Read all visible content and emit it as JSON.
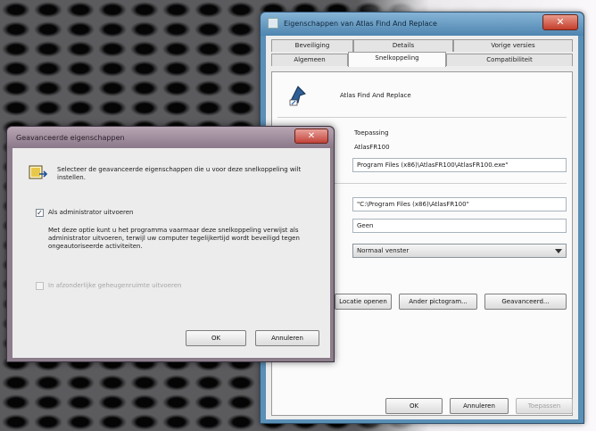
{
  "props": {
    "title": "Eigenschappen van Atlas Find And Replace",
    "tabs_row1": [
      "Beveiliging",
      "Details",
      "Vorige versies"
    ],
    "tabs_row2": [
      "Algemeen",
      "Snelkoppeling",
      "Compatibiliteit"
    ],
    "app_name": "Atlas Find And Replace",
    "type_value": "Toepassing",
    "location_value": "AtlasFR100",
    "target_value": "Program Files (x86)\\AtlasFR100\\AtlasFR100.exe\"",
    "start_in_value": "\"C:\\Program Files (x86)\\AtlasFR100\"",
    "shortcut_key_value": "Geen",
    "run_value": "Normaal venster",
    "btn_open_location": "Locatie openen",
    "btn_change_icon": "Ander pictogram...",
    "btn_advanced": "Geavanceerd...",
    "ok": "OK",
    "cancel": "Annuleren",
    "apply": "Toepassen"
  },
  "adv": {
    "title": "Geavanceerde eigenschappen",
    "intro": "Selecteer de geavanceerde eigenschappen die u voor deze snelkoppeling wilt instellen.",
    "run_as_admin": "Als administrator uitvoeren",
    "run_as_admin_checked": true,
    "admin_desc": "Met deze optie kunt u het programma vaarmaar deze snelkoppeling verwijst als administrator uitvoeren, terwijl uw computer tegelijkertijd wordt beveiligd tegen ongeautoriseerde activiteiten.",
    "separate_memory": "In afzonderlijke geheugenruimte uitvoeren",
    "ok": "OK",
    "cancel": "Annuleren",
    "close_glyph": "✕"
  },
  "colors": {
    "props_titlebar": "#5a8fb6",
    "adv_titlebar": "#8b7d8a",
    "close_button": "#c43d2b"
  },
  "icons": [
    "app-icon",
    "shortcut-icon",
    "close-icon",
    "dropdown-arrow-icon",
    "check-icon",
    "window-icon"
  ]
}
